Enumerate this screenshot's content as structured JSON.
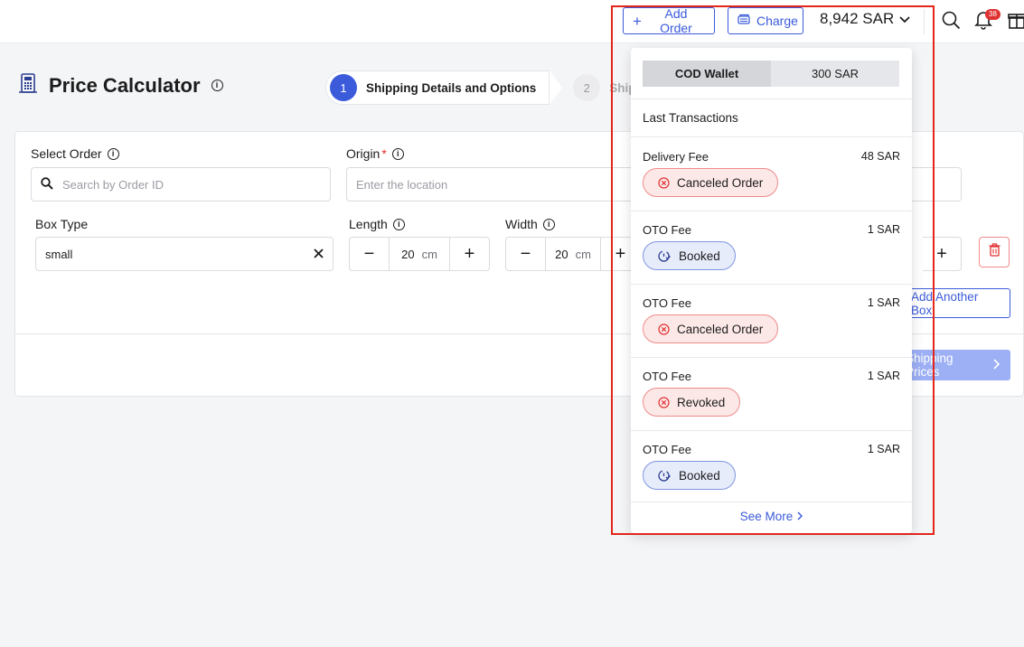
{
  "header": {
    "add_order_label": "Add Order",
    "charge_label": "Charge",
    "balance": "8,942 SAR",
    "notification_count": "38"
  },
  "page": {
    "title": "Price Calculator",
    "steps": [
      {
        "number": "1",
        "label": "Shipping Details and Options"
      },
      {
        "number": "2",
        "label": "Ship"
      }
    ]
  },
  "form": {
    "select_order_label": "Select Order",
    "search_placeholder": "Search by Order ID",
    "origin_label": "Origin",
    "origin_required": "*",
    "origin_placeholder": "Enter the location",
    "box_type_label": "Box Type",
    "box_type_value": "small",
    "length_label": "Length",
    "length_value": "20",
    "width_label": "Width",
    "width_value": "20",
    "unit": "cm",
    "add_box_label": "Add Another Box",
    "prices_label": "Shipping Prices"
  },
  "dropdown": {
    "tabs": [
      "COD Wallet",
      "300 SAR"
    ],
    "heading": "Last Transactions",
    "transactions": [
      {
        "name": "Delivery Fee",
        "amount": "48 SAR",
        "status": "Canceled Order",
        "kind": "canceled"
      },
      {
        "name": "OTO Fee",
        "amount": "1 SAR",
        "status": "Booked",
        "kind": "booked"
      },
      {
        "name": "OTO Fee",
        "amount": "1 SAR",
        "status": "Canceled Order",
        "kind": "canceled"
      },
      {
        "name": "OTO Fee",
        "amount": "1 SAR",
        "status": "Revoked",
        "kind": "canceled"
      },
      {
        "name": "OTO Fee",
        "amount": "1 SAR",
        "status": "Booked",
        "kind": "booked"
      }
    ],
    "see_more": "See More"
  },
  "colors": {
    "accent": "#3b5bdb",
    "danger": "#e03131",
    "highlight": "#e2261a"
  }
}
